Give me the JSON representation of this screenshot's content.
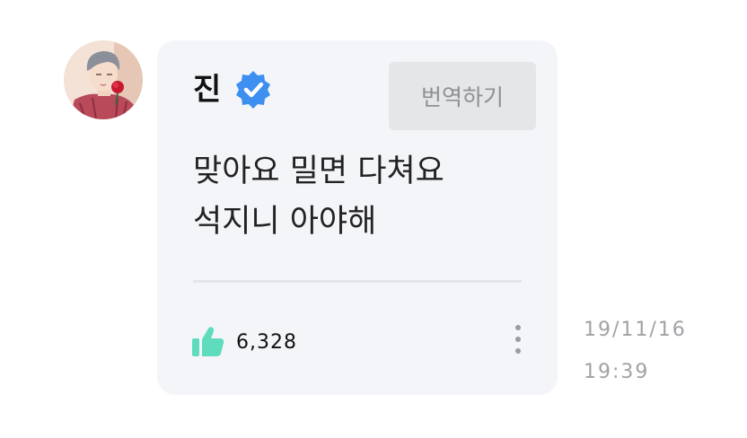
{
  "post": {
    "author": {
      "name": "진",
      "verified_icon": "verified-badge-icon",
      "avatar_icon": "profile-photo"
    },
    "translate_label": "번역하기",
    "message_lines": [
      "맞아요 밀면 다쳐요",
      "석지니 아야해"
    ],
    "likes": {
      "icon": "thumbs-up-icon",
      "count": "6,328"
    },
    "more_icon": "more-vertical-icon",
    "date": "19/11/16",
    "time": "19:39"
  },
  "colors": {
    "card_background": "#f4f5f9",
    "verified_badge": "#3d8ff0",
    "thumbs_up": "#5fdcbd",
    "translate_button": "#e5e6e8",
    "timestamp_text": "#a0a2a6"
  }
}
